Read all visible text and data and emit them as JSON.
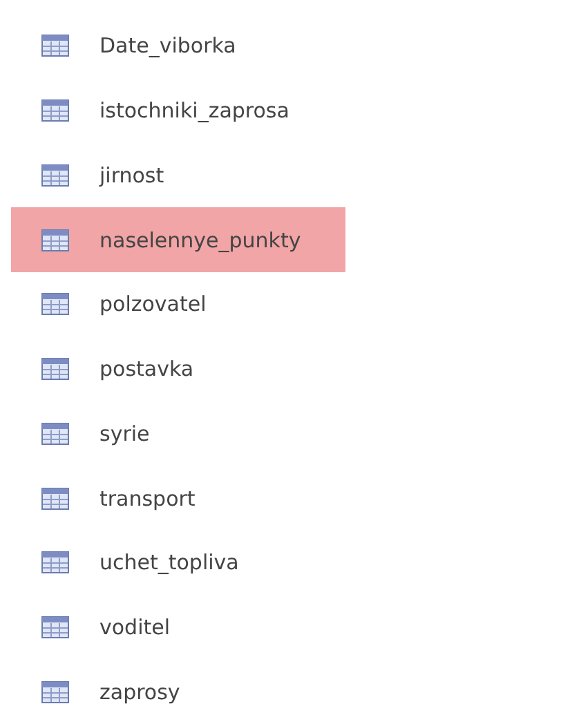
{
  "tables": [
    {
      "name": "Date_viborka",
      "selected": false
    },
    {
      "name": "istochniki_zaprosa",
      "selected": false
    },
    {
      "name": "jirnost",
      "selected": false
    },
    {
      "name": "naselennye_punkty",
      "selected": true
    },
    {
      "name": "polzovatel",
      "selected": false
    },
    {
      "name": "postavka",
      "selected": false
    },
    {
      "name": "syrie",
      "selected": false
    },
    {
      "name": "transport",
      "selected": false
    },
    {
      "name": "uchet_topliva",
      "selected": false
    },
    {
      "name": "voditel",
      "selected": false
    },
    {
      "name": "zaprosy",
      "selected": false
    }
  ]
}
